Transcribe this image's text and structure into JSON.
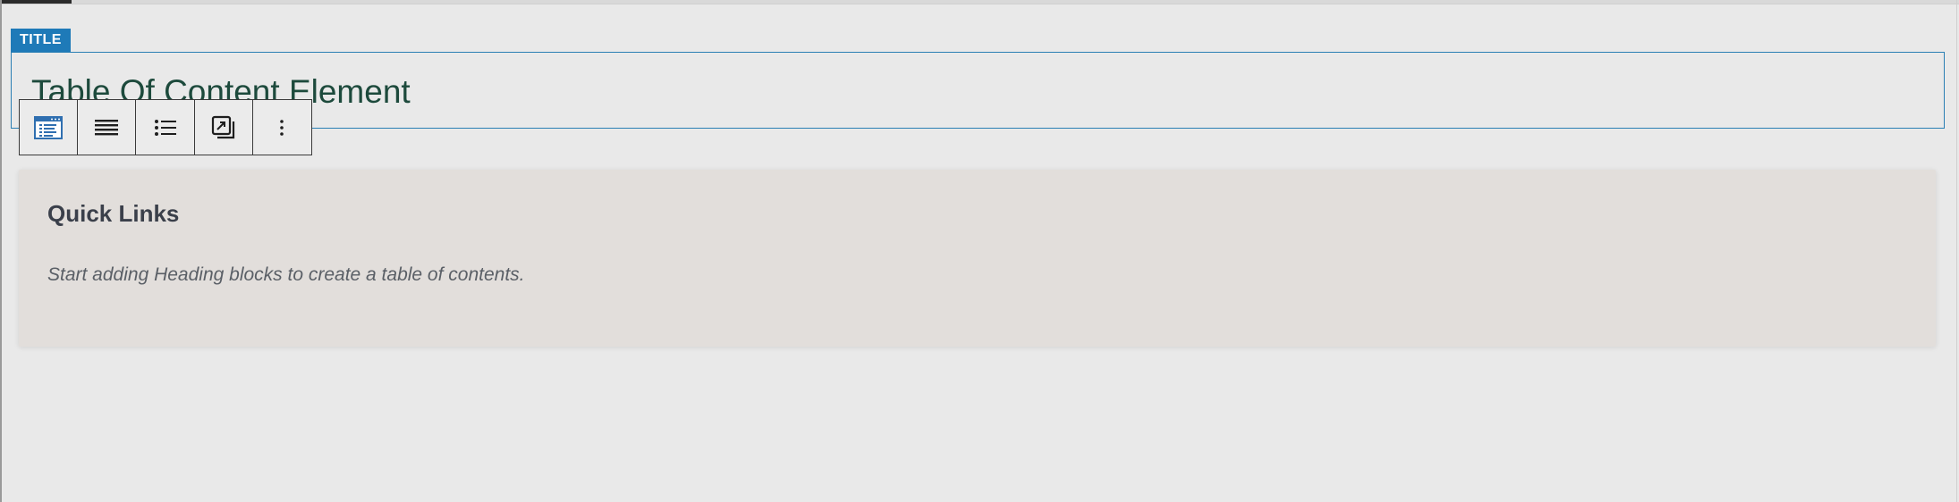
{
  "title_block": {
    "tag_label": "TITLE",
    "heading": "Table Of Content Element"
  },
  "toolbar": {
    "buttons": [
      {
        "icon": "table-of-contents-icon",
        "label": "Table of contents"
      },
      {
        "icon": "align-justify-icon",
        "label": "Align"
      },
      {
        "icon": "list-icon",
        "label": "List"
      },
      {
        "icon": "convert-icon",
        "label": "Convert"
      },
      {
        "icon": "more-options-icon",
        "label": "Options"
      }
    ]
  },
  "toc_block": {
    "heading": "Quick Links",
    "hint": "Start adding Heading blocks to create a table of contents."
  },
  "colors": {
    "accent": "#1e7ab8",
    "title_text": "#1d4a3c",
    "toc_background": "#e2dedb",
    "page_background": "#e9e9e9"
  }
}
